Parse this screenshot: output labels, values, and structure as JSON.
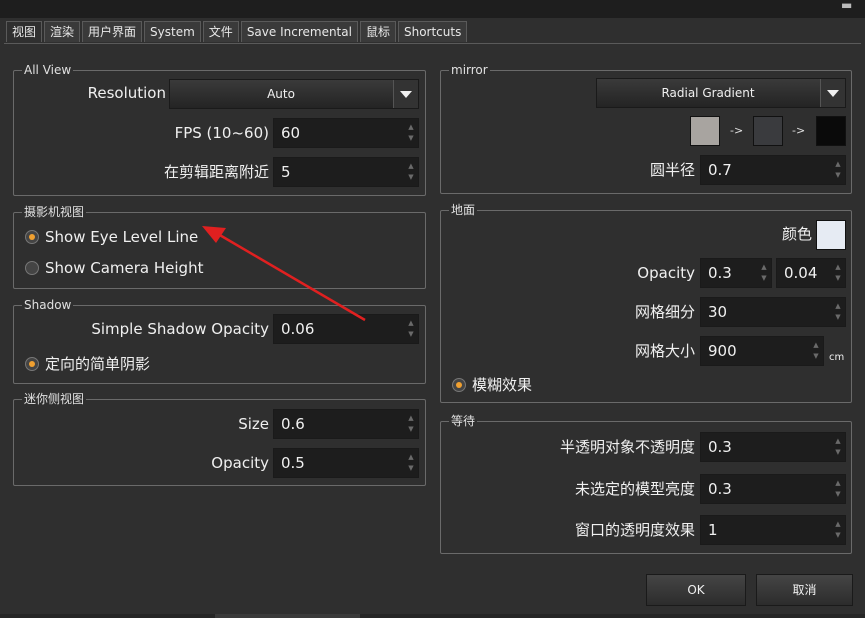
{
  "tabs": [
    "视图",
    "渲染",
    "用户界面",
    "System",
    "文件",
    "Save Incremental",
    "鼠标",
    "Shortcuts"
  ],
  "all_view": {
    "title": "All View",
    "resolution_label": "Resolution",
    "resolution_value": "Auto",
    "fps_label": "FPS (10~60)",
    "fps_value": "60",
    "near_clip_label": "在剪辑距离附近",
    "near_clip_value": "5"
  },
  "camera_view": {
    "title": "摄影机视图",
    "show_eye_level": "Show Eye Level Line",
    "show_camera_height": "Show Camera Height"
  },
  "shadow": {
    "title": "Shadow",
    "opacity_label": "Simple Shadow Opacity",
    "opacity_value": "0.06",
    "directional_label": "定向的简单阴影"
  },
  "mini_side": {
    "title": "迷你侧视图",
    "size_label": "Size",
    "size_value": "0.6",
    "opacity_label": "Opacity",
    "opacity_value": "0.5"
  },
  "mirror": {
    "title": "mirror",
    "gradient_value": "Radial Gradient",
    "arrow_1": "->",
    "arrow_2": "->",
    "radius_label": "圆半径",
    "radius_value": "0.7",
    "colors": [
      "#a8a4a0",
      "#3a3b3e",
      "#0a0a0a"
    ]
  },
  "ground": {
    "title": "地面",
    "color_label": "颜色",
    "color_value": "#e6ebf3",
    "opacity_label": "Opacity",
    "opacity_value_1": "0.3",
    "opacity_value_2": "0.04",
    "grid_subdiv_label": "网格细分",
    "grid_subdiv_value": "30",
    "grid_size_label": "网格大小",
    "grid_size_value": "900",
    "grid_size_unit": "cm",
    "blur_label": "模糊效果"
  },
  "wait": {
    "title": "等待",
    "transparent_label": "半透明对象不透明度",
    "transparent_value": "0.3",
    "unselected_label": "未选定的模型亮度",
    "unselected_value": "0.3",
    "window_label": "窗口的透明度效果",
    "window_value": "1"
  },
  "buttons": {
    "ok": "OK",
    "cancel": "取消"
  },
  "accent_color": "#f0a030",
  "annotation_color": "#e02020"
}
